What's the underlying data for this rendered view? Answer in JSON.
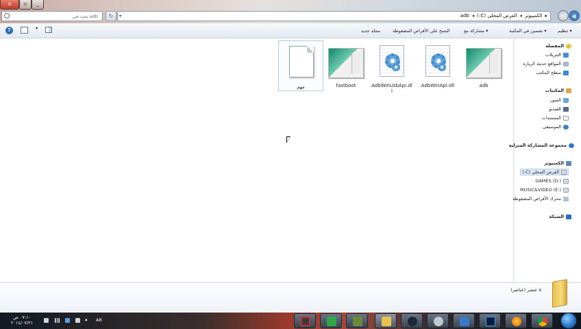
{
  "window": {
    "close_symbol": "x",
    "maximize_symbol": "▫",
    "minimize_symbol": "_"
  },
  "address_bar": {
    "search_placeholder": "بحث في adb",
    "refresh_symbol": "↻",
    "dropdown_symbol": "▾",
    "crumbs": [
      "الكمبيوتر",
      "القرص المحلي (C:)",
      "adb"
    ],
    "crumb_separator": "◂",
    "lead_arrow": "▸"
  },
  "toolbar": {
    "organize": "تنظيم ▾",
    "include_in_library": "تضمين في المكتبة ▾",
    "share_with": "مشاركة مع ▾",
    "burn": "النسخ على الأقراص المضغوطة",
    "new_folder": "مجلد جديد",
    "help_symbol": "?",
    "view_dropdown_symbol": "▾"
  },
  "files": [
    {
      "name": "adb",
      "kind": "image"
    },
    {
      "name": "AdbWinApi.dll",
      "kind": "dll"
    },
    {
      "name": "AdbWinUsbApi.dll",
      "kind": "dll"
    },
    {
      "name": "fastboot",
      "kind": "image"
    },
    {
      "name": "مهم",
      "kind": "text",
      "selected": true
    }
  ],
  "nav": {
    "favorites": "المفضلة",
    "downloads": "التنزيلات",
    "recent": "المواقع حديثة الزيارة",
    "desktop": "سطح المكتب",
    "libraries": "المكتبات",
    "pictures": "الصور",
    "videos": "الفيديو",
    "documents": "المستندات",
    "music": "الموسيقى",
    "homegroup": "مجموعة المشاركة المنزلية",
    "computer": "الكمبيوتر",
    "drive_c": "القرص المحلي (C:)",
    "drive_d": "GAMES (D:)",
    "drive_e": "MUSIC&VIDEO (E:)",
    "dvd": "محرك الأقراص المضغوطة",
    "network": "الشبكة"
  },
  "status": {
    "item_count": "٥ عنصر (عناصر)"
  },
  "taskbar": {
    "time": "٠٧:١٠ ص",
    "date": "٢٠١٤/٠٧/٢١",
    "language": "AR",
    "apps": [
      "video-recorder",
      "task-manager",
      "media",
      "explorer",
      "steam",
      "app",
      "app2",
      "photoshop",
      "firefox",
      "chrome"
    ]
  },
  "colors": {
    "accent": "#2d6db5",
    "selection": "#dce8f6"
  }
}
